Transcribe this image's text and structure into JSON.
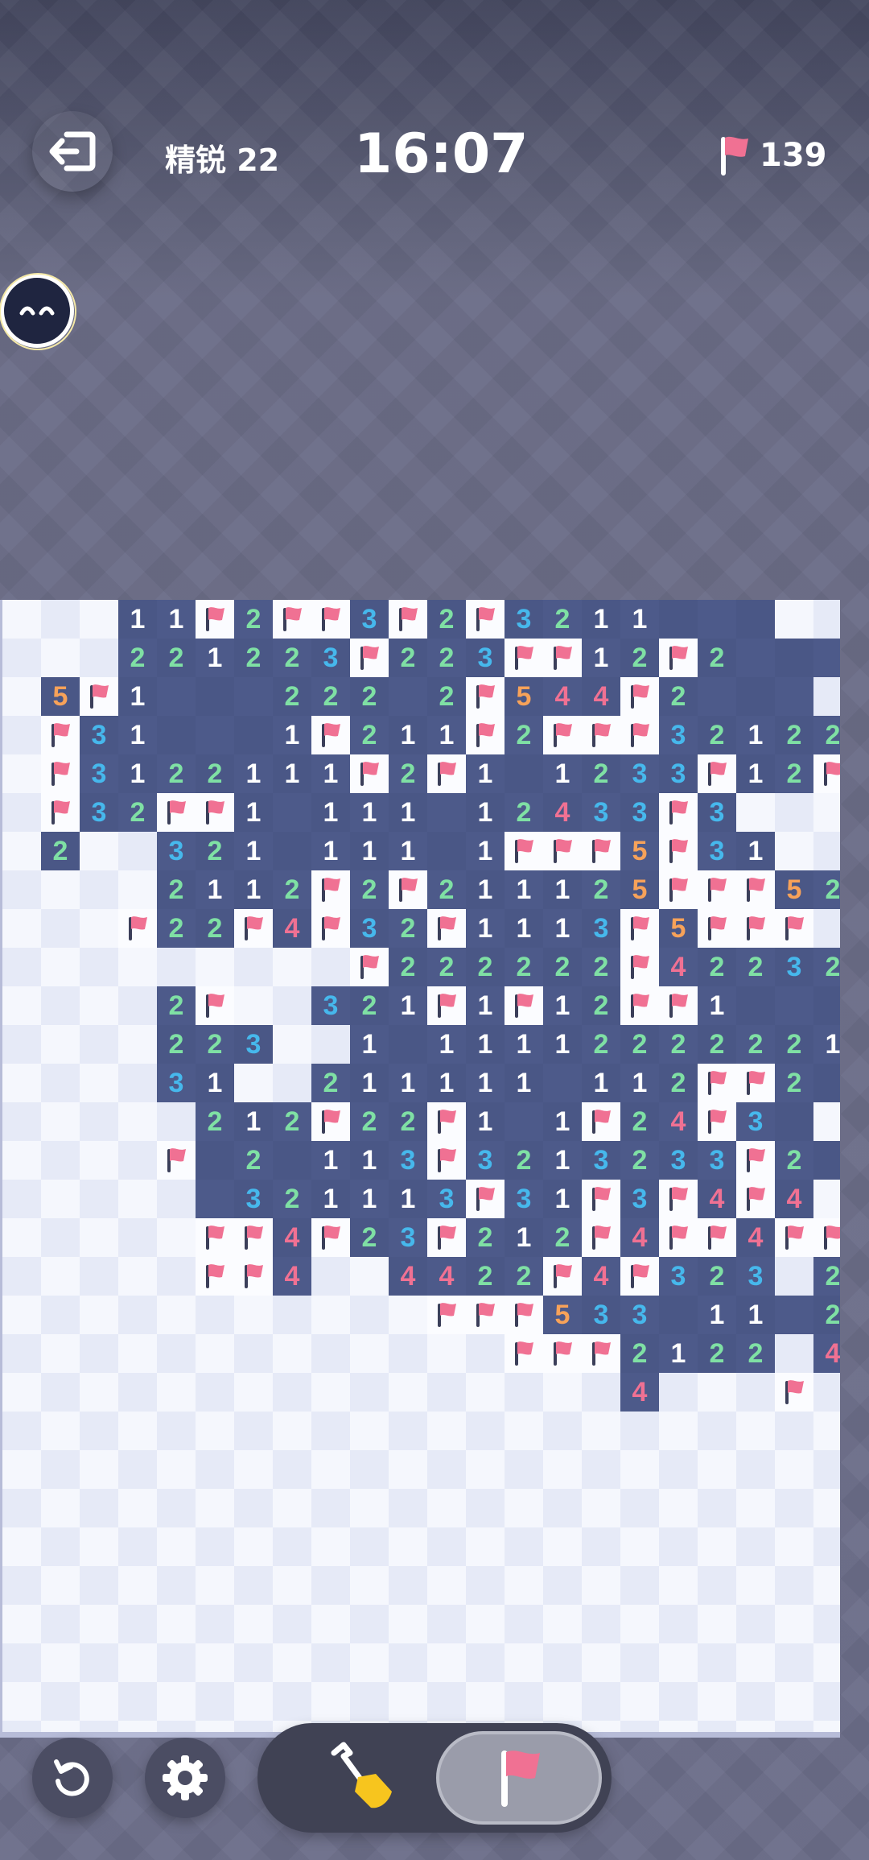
{
  "header": {
    "level_label": "精锐 22",
    "timer": "16:07",
    "flags_remaining": "139"
  },
  "icons": {
    "exit": "exit-icon",
    "flag": "flag-icon",
    "restart": "restart-icon",
    "settings": "gear-icon",
    "dig": "shovel-icon",
    "avatar": "mascot-avatar"
  },
  "colors": {
    "revealed_cell": "#4d5a8a",
    "hidden_cell_light": "#f5f7fd",
    "hidden_cell_alt": "#e6eaf7",
    "flag": "#f07193",
    "number_1": "#ffffff",
    "number_2": "#7fe0a4",
    "number_3": "#46b8ec",
    "number_4": "#f07193",
    "number_5": "#f7a259"
  },
  "board": {
    "legend": "H=hidden, R=revealed empty, F=flag, digit=revealed number",
    "rows": [
      "HHH11F2FF3F2F3211RRR",
      "HHH221223F223FF12F2RRR",
      "H5F1RRR222R2F544F2RRR",
      "HF31RRR1F211F2FFF32122",
      "HF3122111F2F1R1233F12FF",
      "HF32FF1R111R12433F3",
      "H2HH321R111R1FFF5F31",
      "HHHH2112F2F211125FFF52",
      "HHHF22F4F32F1113F5FFF",
      "HHHHHHHHHF222222F42232",
      "HHHH2FHH321F1F12FF1RRRR",
      "HHHH223HH1R11112222221R",
      "HHHH31HH211111R112FF2R",
      "HHHHH212F22F1R1F24F3R",
      "HHHHFR2R113F3213233F2R",
      "HHHHHR321113F31F3F4F4H31",
      "HHHHHFF4F23F212F4FF4FF1",
      "HHHHHFF4HH4422F4F323H2",
      "HHHHHHHHHHHFFF533R11R2F",
      "HHHHHHHHHHHHHFFF2122H4F",
      "HHHHHHHHHHHHHHHH4HHHF"
    ]
  }
}
